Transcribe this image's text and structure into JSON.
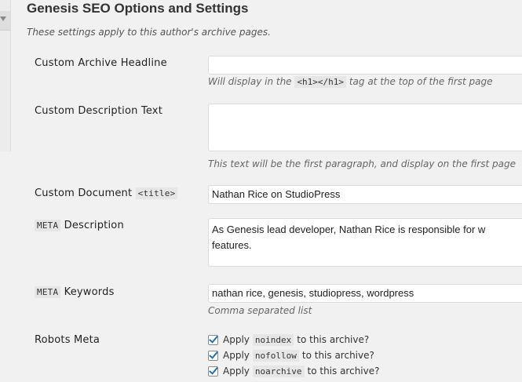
{
  "page": {
    "title": "Genesis SEO Options and Settings",
    "intro": "These settings apply to this author's archive pages."
  },
  "fields": {
    "headline": {
      "label": "Custom Archive Headline",
      "value": "",
      "hint_before": "Will display in the",
      "hint_code": "<h1></h1>",
      "hint_after": "tag at the top of the first page"
    },
    "description_text": {
      "label": "Custom Description Text",
      "value": "",
      "hint": "This text will be the first paragraph, and display on the first page"
    },
    "doc_title": {
      "label": "Custom Document",
      "label_code": "<title>",
      "value": "Nathan Rice on StudioPress"
    },
    "meta_description": {
      "label_code": "META",
      "label": "Description",
      "value": "As Genesis lead developer, Nathan Rice is responsible for w\nfeatures."
    },
    "meta_keywords": {
      "label_code": "META",
      "label": "Keywords",
      "value": "nathan rice, genesis, studiopress, wordpress",
      "hint": "Comma separated list"
    }
  },
  "robots": {
    "label": "Robots Meta",
    "options": [
      {
        "prefix": "Apply",
        "code": "noindex",
        "suffix": "to this archive?",
        "checked": true
      },
      {
        "prefix": "Apply",
        "code": "nofollow",
        "suffix": "to this archive?",
        "checked": true
      },
      {
        "prefix": "Apply",
        "code": "noarchive",
        "suffix": "to this archive?",
        "checked": true
      }
    ]
  }
}
